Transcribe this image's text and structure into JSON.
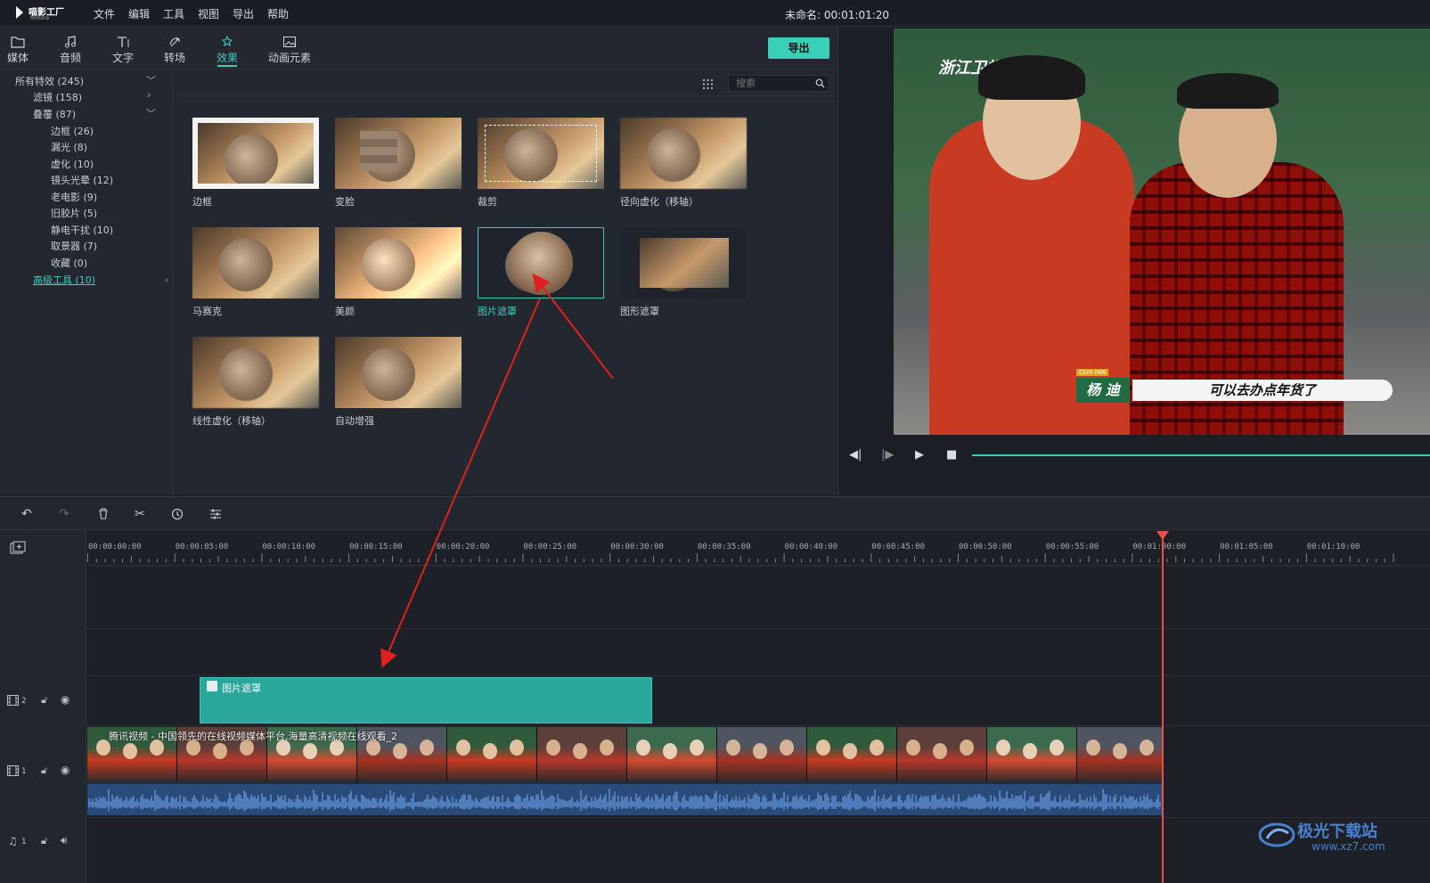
{
  "app": {
    "name": "喵影工厂",
    "sub": "filmora",
    "doc_title": "未命名: 00:01:01:20"
  },
  "menu": [
    "文件",
    "编辑",
    "工具",
    "视图",
    "导出",
    "帮助"
  ],
  "tabs": [
    {
      "label": "媒体",
      "icon": "folder-icon"
    },
    {
      "label": "音频",
      "icon": "music-note-icon"
    },
    {
      "label": "文字",
      "icon": "text-icon"
    },
    {
      "label": "转场",
      "icon": "transition-icon"
    },
    {
      "label": "效果",
      "icon": "effects-icon",
      "active": true
    },
    {
      "label": "动画元素",
      "icon": "image-icon"
    }
  ],
  "export_label": "导出",
  "tree": [
    {
      "label": "所有特效 (245)",
      "level": 0,
      "chevron": "down"
    },
    {
      "label": "滤镜 (158)",
      "level": 1,
      "chevron": "right"
    },
    {
      "label": "叠覆 (87)",
      "level": 1,
      "chevron": "down"
    },
    {
      "label": "边框 (26)",
      "level": 2
    },
    {
      "label": "漏光 (8)",
      "level": 2
    },
    {
      "label": "虚化 (10)",
      "level": 2
    },
    {
      "label": "镜头光晕 (12)",
      "level": 2
    },
    {
      "label": "老电影 (9)",
      "level": 2
    },
    {
      "label": "旧胶片 (5)",
      "level": 2
    },
    {
      "label": "静电干扰 (10)",
      "level": 2
    },
    {
      "label": "取景器 (7)",
      "level": 2
    },
    {
      "label": "收藏 (0)",
      "level": 2
    },
    {
      "label": "高级工具 (10)",
      "level": 1,
      "link": true
    }
  ],
  "search": {
    "placeholder": "搜索"
  },
  "effects": [
    {
      "name": "边框"
    },
    {
      "name": "变脸"
    },
    {
      "name": "裁剪"
    },
    {
      "name": "径向虚化（移轴）"
    },
    {
      "name": "马赛克"
    },
    {
      "name": "美颜"
    },
    {
      "name": "图片遮罩",
      "selected": true
    },
    {
      "name": "图形遮罩"
    },
    {
      "name": "线性虚化（移轴）"
    },
    {
      "name": "自动增强"
    }
  ],
  "preview": {
    "channel_logo": "浙江卫视",
    "caption_name": "杨 迪",
    "caption_text": "可以去办点年货了",
    "caption_tag": "OUR INN"
  },
  "ruler_ticks": [
    "00:00:00:00",
    "00:00:05:00",
    "00:00:10:00",
    "00:00:15:00",
    "00:00:20:00",
    "00:00:25:00",
    "00:00:30:00",
    "00:00:35:00",
    "00:00:40:00",
    "00:00:45:00",
    "00:00:50:00",
    "00:00:55:00",
    "00:01:00:00",
    "00:01:05:00",
    "00:01:10:00"
  ],
  "tracks": {
    "video2_label": "2",
    "video1_label": "1",
    "audio1_label": "1",
    "effect_clip": "图片遮罩",
    "video_clip": "腾讯视频 - 中国领先的在线视频媒体平台,海量高清视频在线观看_2"
  },
  "watermark": {
    "title": "极光下载站",
    "url": "www.xz7.com"
  },
  "colors": {
    "accent": "#3fc9bd",
    "playhead": "#e8524a",
    "arrow": "#e02020",
    "effect_clip": "#2aa79b",
    "audio": "#2a4a7a"
  }
}
